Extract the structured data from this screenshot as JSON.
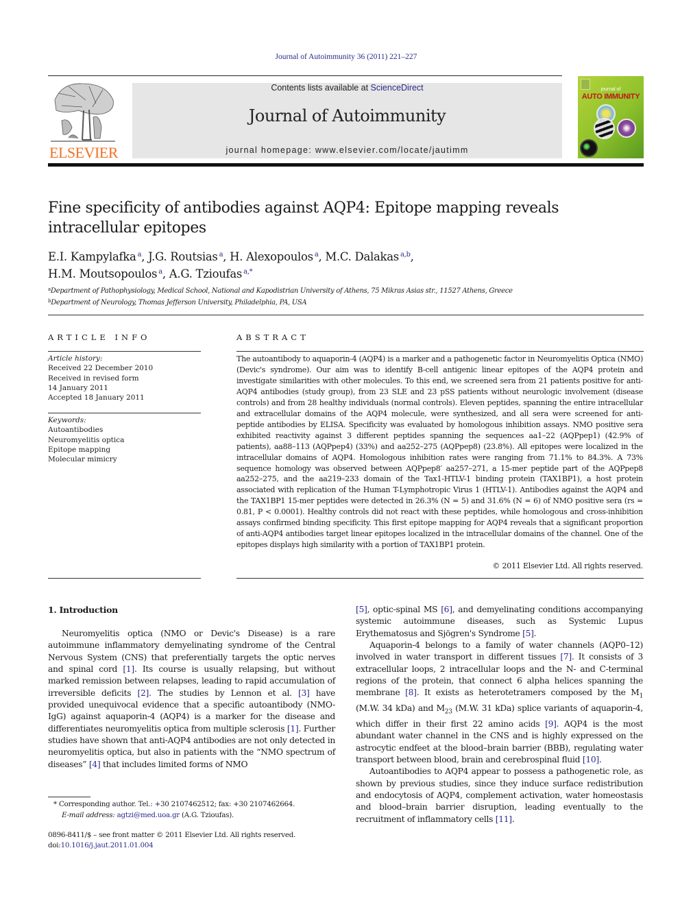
{
  "header": {
    "citation": "Journal of Autoimmunity 36 (2011) 221–227",
    "contents_prefix": "Contents lists available at ",
    "contents_link": "ScienceDirect",
    "journal_name": "Journal of Autoimmunity",
    "homepage": "journal homepage: www.elsevier.com/locate/jautimm",
    "publisher_logo_text": "ELSEVIER",
    "cover": {
      "journal_of": "journal of",
      "title": "AUTO IMMUNITY"
    },
    "colors": {
      "link": "#2a2a8c",
      "elsevier_orange": "#f26f21",
      "masthead_bg": "#e6e6e6",
      "cover_green": "#9bc82e"
    }
  },
  "article": {
    "title": "Fine specificity of antibodies against AQP4: Epitope mapping reveals intracellular epitopes",
    "authors": [
      {
        "name": "E.I. Kampylafka",
        "aff": "a"
      },
      {
        "name": "J.G. Routsias",
        "aff": "a"
      },
      {
        "name": "H. Alexopoulos",
        "aff": "a"
      },
      {
        "name": "M.C. Dalakas",
        "aff": "a,b"
      },
      {
        "name": "H.M. Moutsopoulos",
        "aff": "a"
      },
      {
        "name": "A.G. Tzioufas",
        "aff": "a,*"
      }
    ],
    "affiliations": [
      {
        "mark": "a",
        "text": "Department of Pathophysiology, Medical School, National and Kapodistrian University of Athens, 75 Mikras Asias str., 11527 Athens, Greece"
      },
      {
        "mark": "b",
        "text": "Department of Neurology, Thomas Jefferson University, Philadelphia, PA, USA"
      }
    ]
  },
  "article_info": {
    "heading": "ARTICLE INFO",
    "history_label": "Article history:",
    "history": [
      "Received 22 December 2010",
      "Received in revised form",
      "14 January 2011",
      "Accepted 18 January 2011"
    ],
    "keywords_label": "Keywords:",
    "keywords": [
      "Autoantibodies",
      "Neuromyelitis optica",
      "Epitope mapping",
      "Molecular mimicry"
    ]
  },
  "abstract": {
    "heading": "ABSTRACT",
    "text": "The autoantibody to aquaporin-4 (AQP4) is a marker and a pathogenetic factor in Neuromyelitis Optica (NMO) (Devic's syndrome). Our aim was to identify B-cell antigenic linear epitopes of the AQP4 protein and investigate similarities with other molecules. To this end, we screened sera from 21 patients positive for anti-AQP4 antibodies (study group), from 23 SLE and 23 pSS patients without neurologic involvement (disease controls) and from 28 healthy individuals (normal controls). Eleven peptides, spanning the entire intracellular and extracellular domains of the AQP4 molecule, were synthesized, and all sera were screened for anti-peptide antibodies by ELISA. Specificity was evaluated by homologous inhibition assays. NMO positive sera exhibited reactivity against 3 different peptides spanning the sequences aa1–22 (AQPpep1) (42.9% of patients), aa88–113 (AQPpep4) (33%) and aa252–275 (AQPpep8) (23.8%). All epitopes were localized in the intracellular domains of AQP4. Homologous inhibition rates were ranging from 71.1% to 84.3%. A 73% sequence homology was observed between AQPpep8′ aa257–271, a 15-mer peptide part of the AQPpep8 aa252–275, and the aa219–233 domain of the Tax1-HTLV-1 binding protein (TAX1BP1), a host protein associated with replication of the Human T-Lymphotropic Virus 1 (HTLV-1). Antibodies against the AQP4 and the TAX1BP1 15-mer peptides were detected in 26.3% (N = 5) and 31.6% (N = 6) of NMO positive sera (rs = 0.81, P < 0.0001). Healthy controls did not react with these peptides, while homologous and cross-inhibition assays confirmed binding specificity. This first epitope mapping for AQP4 reveals that a significant proportion of anti-AQP4 antibodies target linear epitopes localized in the intracellular domains of the channel. One of the epitopes displays high similarity with a portion of TAX1BP1 protein.",
    "copyright": "© 2011 Elsevier Ltd. All rights reserved."
  },
  "body": {
    "section_heading": "1.  Introduction",
    "left_paragraphs": [
      [
        {
          "t": "Neuromyelitis optica (NMO or Devic's Disease) is a rare autoimmune inflammatory demyelinating syndrome of the Central Nervous System (CNS) that preferentially targets the optic nerves and spinal cord "
        },
        {
          "c": "[1]"
        },
        {
          "t": ". Its course is usually relapsing, but without marked remission between relapses, leading to rapid accumulation of irreversible deficits "
        },
        {
          "c": "[2]"
        },
        {
          "t": ". The studies by Lennon et al. "
        },
        {
          "c": "[3]"
        },
        {
          "t": " have provided unequivocal evidence that a specific autoantibody (NMO-IgG) against aquaporin-4 (AQP4) is a marker for the disease and differentiates neuromyelitis optica from multiple sclerosis "
        },
        {
          "c": "[1]"
        },
        {
          "t": ". Further studies have shown that anti-AQP4 antibodies are not only detected in neuromyelitis optica, but also in patients with the “NMO spectrum of diseases” "
        },
        {
          "c": "[4]"
        },
        {
          "t": " that includes limited forms of NMO"
        }
      ]
    ],
    "right_paragraphs": [
      [
        {
          "c": "[5]"
        },
        {
          "t": ", optic-spinal MS "
        },
        {
          "c": "[6]"
        },
        {
          "t": ", and demyelinating conditions accompanying systemic autoimmune diseases, such as Systemic Lupus Erythematosus and Sjögren's Syndrome "
        },
        {
          "c": "[5]"
        },
        {
          "t": "."
        }
      ],
      [
        {
          "t": "Aquaporin-4 belongs to a family of water channels (AQP0–12) involved in water transport in different tissues "
        },
        {
          "c": "[7]"
        },
        {
          "t": ". It consists of 3 extracellular loops, 2 intracellular loops and the N- and C-terminal regions of the protein, that connect 6 alpha helices spanning the membrane "
        },
        {
          "c": "[8]"
        },
        {
          "t": ". It exists as heterotetramers composed by the M"
        },
        {
          "s": "1"
        },
        {
          "t": " (M.W. 34 kDa) and M"
        },
        {
          "s": "23"
        },
        {
          "t": " (M.W. 31 kDa) splice variants of aquaporin-4, which differ in their first 22 amino acids "
        },
        {
          "c": "[9]"
        },
        {
          "t": ". AQP4 is the most abundant water channel in the CNS and is highly expressed on the astrocytic endfeet at the blood–brain barrier (BBB), regulating water transport between blood, brain and cerebrospinal fluid "
        },
        {
          "c": "[10]"
        },
        {
          "t": "."
        }
      ],
      [
        {
          "t": "Autoantibodies to AQP4 appear to possess a pathogenetic role, as shown by previous studies, since they induce surface redistribution and endocytosis of AQP4, complement activation, water homeostasis and blood–brain barrier disruption, leading eventually to the recruitment of inflammatory cells "
        },
        {
          "c": "[11]"
        },
        {
          "t": "."
        }
      ]
    ]
  },
  "footnotes": {
    "corresponding": "*  Corresponding author. Tel.: +30 2107462512; fax: +30 2107462664.",
    "email_label": "E-mail address:",
    "email": "agtzi@med.uoa.gr",
    "email_suffix": " (A.G. Tzioufas).",
    "front_matter": "0896-8411/$ – see front matter © 2011 Elsevier Ltd. All rights reserved.",
    "doi_label": "doi:",
    "doi": "10.1016/j.jaut.2011.01.004"
  }
}
